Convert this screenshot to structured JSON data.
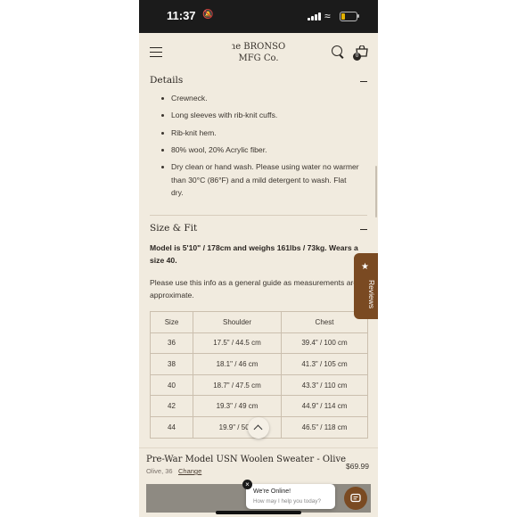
{
  "status_bar": {
    "time": "11:37"
  },
  "header": {
    "logo_line1": "The BRONSON",
    "logo_line2": "MFG Co.",
    "cart_count": "0"
  },
  "details": {
    "title": "Details",
    "bullets": [
      "Crewneck.",
      "Long sleeves with rib-knit cuffs.",
      "Rib-knit hem.",
      "80% wool, 20% Acrylic fiber.",
      "Dry clean or hand wash. Please using water no warmer than 30°C (86°F) and a mild detergent to wash. Flat dry."
    ]
  },
  "size_fit": {
    "title": "Size & Fit",
    "model_text": "Model is 5'10\" / 178cm and weighs 161lbs / 73kg. Wears a size 40.",
    "guide_text": "Please use this info as a general guide as measurements are approximate.",
    "table": {
      "headers": [
        "Size",
        "Shoulder",
        "Chest"
      ],
      "rows": [
        [
          "36",
          "17.5\" / 44.5 cm",
          "39.4\" / 100 cm"
        ],
        [
          "38",
          "18.1\" / 46 cm",
          "41.3\" / 105 cm"
        ],
        [
          "40",
          "18.7\" / 47.5 cm",
          "43.3\" / 110 cm"
        ],
        [
          "42",
          "19.3\" / 49 cm",
          "44.9\" / 114 cm"
        ],
        [
          "44",
          "19.9\" / 50.5",
          "46.5\" / 118 cm"
        ]
      ]
    }
  },
  "reviews_tab": {
    "label": "Reviews"
  },
  "bottom_bar": {
    "product_title": "Pre-War Model USN Woolen Sweater - Olive",
    "variant": "Olive, 36",
    "change_label": "Change",
    "price": "$69.99"
  },
  "chat": {
    "title": "We're Online!",
    "subtitle": "How may I help you today?"
  },
  "colors": {
    "background": "#f1ebdf",
    "accent_brown": "#7a4a22",
    "text": "#3a342e"
  },
  "icons": [
    "bell-icon",
    "hamburger-icon",
    "search-icon",
    "cart-icon",
    "star-icon",
    "chevron-up-icon",
    "close-icon",
    "chat-icon"
  ]
}
